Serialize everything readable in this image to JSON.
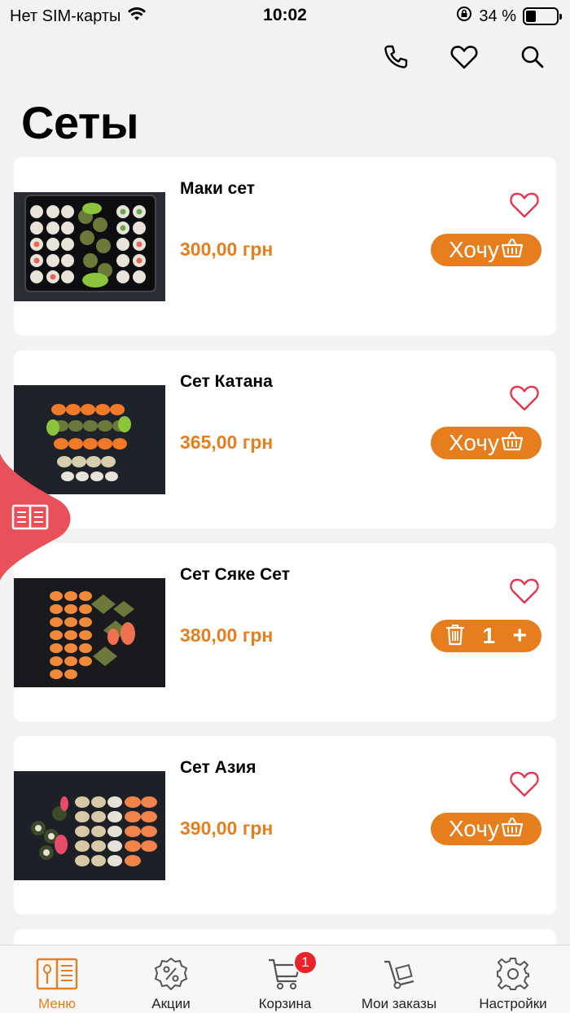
{
  "status_bar": {
    "carrier": "Нет SIM-карты",
    "time": "10:02",
    "battery_percent": "34 %",
    "battery_level": 0.34
  },
  "header": {
    "title": "Сеты",
    "icons": [
      "phone-icon",
      "heart-icon",
      "search-icon"
    ]
  },
  "colors": {
    "accent": "#e67e1e",
    "favorite": "#e8344e",
    "badge": "#e8232a",
    "floating_menu": "#e8515a"
  },
  "products": [
    {
      "name": "Маки сет",
      "price": "300,00 грн",
      "button": "Хочу",
      "in_cart": false
    },
    {
      "name": "Сет Катана",
      "price": "365,00 грн",
      "button": "Хочу",
      "in_cart": false
    },
    {
      "name": "Сет Сяке Сет",
      "price": "380,00 грн",
      "in_cart": true,
      "quantity": "1",
      "plus": "+"
    },
    {
      "name": "Сет Азия",
      "price": "390,00 грн",
      "button": "Хочу",
      "in_cart": false
    }
  ],
  "tabs": [
    {
      "label": "Меню",
      "icon": "menu-book-icon",
      "active": true
    },
    {
      "label": "Акции",
      "icon": "discount-icon",
      "active": false
    },
    {
      "label": "Корзина",
      "icon": "cart-icon",
      "active": false,
      "badge": "1"
    },
    {
      "label": "Мои заказы",
      "icon": "delivery-icon",
      "active": false
    },
    {
      "label": "Настройки",
      "icon": "gear-icon",
      "active": false
    }
  ]
}
